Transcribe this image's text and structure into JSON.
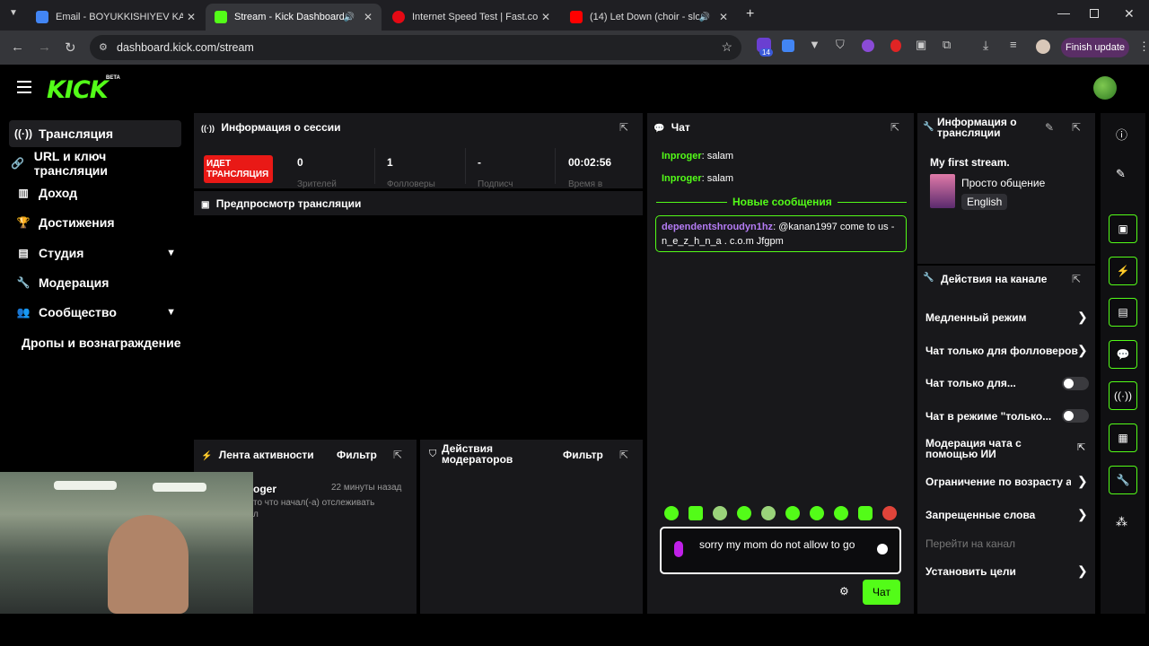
{
  "browser": {
    "tabs": [
      {
        "title": "Email - BOYUKKISHIYEV KANAN",
        "color": "#4285f4"
      },
      {
        "title": "Stream - Kick Dashboard",
        "color": "#53fc18"
      },
      {
        "title": "Internet Speed Test | Fast.com",
        "color": "#e50914"
      },
      {
        "title": "(14) Let Down (choir - slow",
        "color": "#ff0000"
      }
    ],
    "url": "dashboard.kick.com/stream",
    "ext_badge": "14",
    "finish_update": "Finish update"
  },
  "app": {
    "logo": "KICK",
    "beta": "BETA"
  },
  "sidebar": {
    "items": [
      {
        "label": "Трансляция",
        "icon": "broadcast-icon"
      },
      {
        "label": "URL и ключ трансляции",
        "icon": "link-icon"
      },
      {
        "label": "Доход",
        "icon": "chart-icon"
      },
      {
        "label": "Достижения",
        "icon": "trophy-icon"
      },
      {
        "label": "Студия",
        "icon": "studio-icon"
      },
      {
        "label": "Модерация",
        "icon": "wrench-icon"
      },
      {
        "label": "Сообщество",
        "icon": "people-icon"
      },
      {
        "label": "Дропы и вознаграждение",
        "icon": ""
      }
    ]
  },
  "session": {
    "title": "Информация о сессии",
    "live_badge": "ИДЕТ\nТРАНСЛЯЦИЯ",
    "stats": [
      {
        "value": "0",
        "label": "Зрителей"
      },
      {
        "value": "1",
        "label": "Фолловеры"
      },
      {
        "value": "-",
        "label": "Подписч"
      },
      {
        "value": "00:02:56",
        "label": "Время в"
      }
    ]
  },
  "preview": {
    "title": "Предпросмотр трансляции"
  },
  "activity": {
    "title": "Лента активности",
    "filter": "Фильтр",
    "entry_user": "oger",
    "entry_time": "22 минуты назад",
    "entry_text": "то что начал(-а) отслеживать",
    "entry_extra": "л"
  },
  "modactions": {
    "title": "Действия модераторов",
    "filter": "Фильтр"
  },
  "chat": {
    "title": "Чат",
    "messages": [
      {
        "user": "Inproger",
        "text": "salam"
      },
      {
        "user": "Inproger",
        "text": "salam"
      }
    ],
    "new_messages": "Новые сообщения",
    "highlight_user": "dependentshroudyn1hz",
    "highlight_text": "@kanan1997 come to us - n_e_z_h_n_a . c.o.m Jfgpm",
    "input_text": "sorry my mom do not allow to go",
    "send_label": "Чат"
  },
  "stream_info": {
    "title": "Информация о трансляции",
    "stream_title": "My first stream.",
    "category": "Просто общение",
    "language": "English"
  },
  "channel_actions": {
    "title": "Действия на канале",
    "items": [
      {
        "label": "Медленный режим",
        "control": "arrow"
      },
      {
        "label": "Чат только для фолловеров",
        "control": "arrow"
      },
      {
        "label": "Чат только для...",
        "control": "toggle"
      },
      {
        "label": "Чат в режиме \"только...",
        "control": "toggle"
      },
      {
        "label": "Модерация чата с помощью ИИ",
        "control": "external"
      },
      {
        "label": "Ограничение по возрасту а",
        "control": "arrow"
      },
      {
        "label": "Запрещенные слова",
        "control": "arrow"
      },
      {
        "label": "Перейти на канал",
        "control": "none"
      },
      {
        "label": "Установить цели",
        "control": "arrow"
      }
    ]
  }
}
